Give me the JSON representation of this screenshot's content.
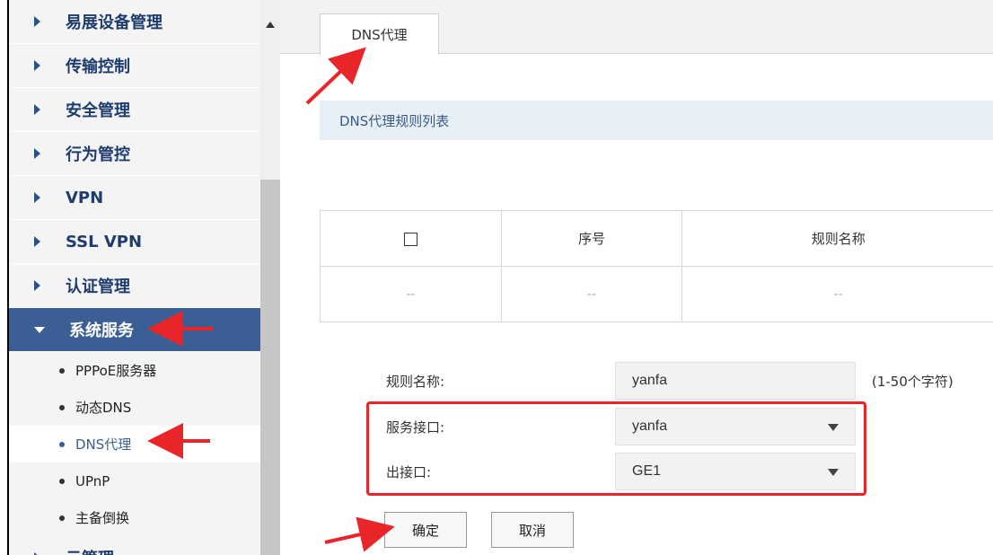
{
  "sidebar": {
    "menu": [
      {
        "label": "易展设备管理"
      },
      {
        "label": "传输控制"
      },
      {
        "label": "安全管理"
      },
      {
        "label": "行为管控"
      },
      {
        "label": "VPN"
      },
      {
        "label": "SSL VPN"
      },
      {
        "label": "认证管理"
      }
    ],
    "active": {
      "label": "系统服务"
    },
    "submenu": [
      {
        "label": "PPPoE服务器"
      },
      {
        "label": "动态DNS"
      },
      {
        "label": "DNS代理"
      },
      {
        "label": "UPnP"
      },
      {
        "label": "主备倒换"
      }
    ],
    "next_partial": {
      "label": "云管理"
    }
  },
  "main": {
    "tab": "DNS代理",
    "section_title": "DNS代理规则列表",
    "table": {
      "headers": [
        "序号",
        "规则名称"
      ],
      "empty_row": [
        "--",
        "--",
        "--"
      ]
    },
    "form": {
      "rule_name_label": "规则名称:",
      "rule_name_value": "yanfa",
      "rule_name_hint": "(1-50个字符)",
      "service_if_label": "服务接口:",
      "service_if_value": "yanfa",
      "out_if_label": "出接口:",
      "out_if_value": "GE1"
    },
    "buttons": {
      "ok": "确定",
      "cancel": "取消"
    }
  },
  "colors": {
    "accent": "#3b5e94",
    "annotation": "#e8262a",
    "section_bg": "#e8f0f7"
  }
}
